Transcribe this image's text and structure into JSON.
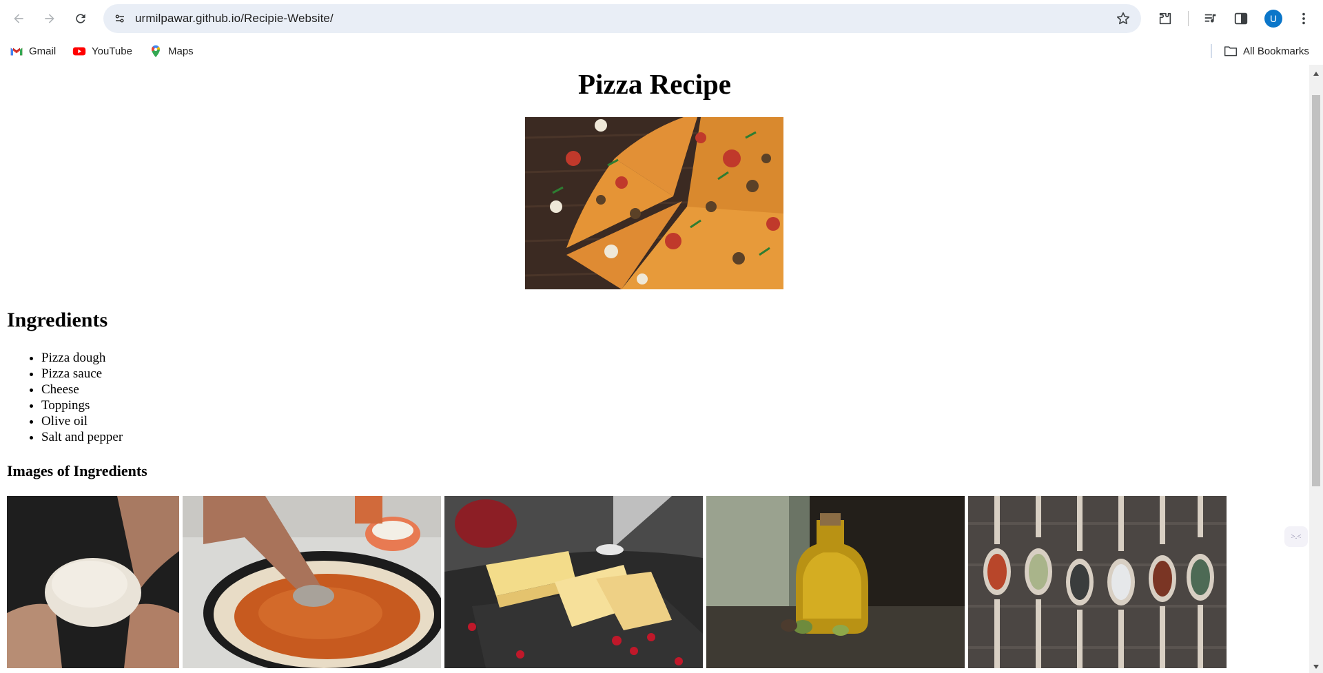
{
  "browser": {
    "url": "urmilpawar.github.io/Recipie-Website/",
    "profile_initial": "U",
    "bookmarks": [
      {
        "label": "Gmail",
        "icon": "gmail-icon"
      },
      {
        "label": "YouTube",
        "icon": "youtube-icon"
      },
      {
        "label": "Maps",
        "icon": "maps-icon"
      }
    ],
    "all_bookmarks": "All Bookmarks"
  },
  "page": {
    "title": "Pizza Recipe",
    "ingredients_heading": "Ingredients",
    "ingredients": [
      "Pizza dough",
      "Pizza sauce",
      "Cheese",
      "Toppings",
      "Olive oil",
      "Salt and pepper"
    ],
    "images_heading": "Images of Ingredients",
    "gallery": [
      "dough-photo",
      "sauce-photo",
      "cheese-photo",
      "olive-oil-photo",
      "spices-photo"
    ]
  },
  "colors": {
    "accent": "#0b76c9",
    "omnibox": "#e9eef6"
  }
}
